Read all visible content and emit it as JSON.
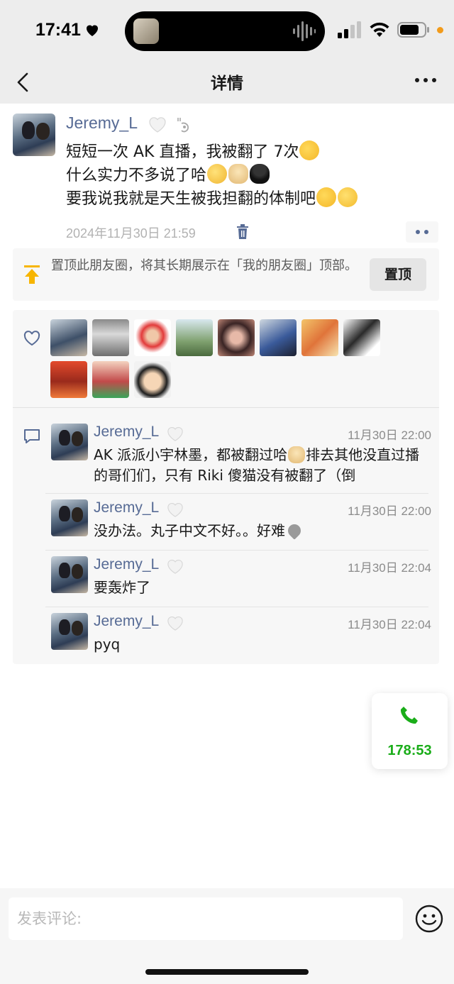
{
  "status_bar": {
    "time": "17:41"
  },
  "nav": {
    "title": "详情"
  },
  "post": {
    "author": "Jeremy_L",
    "text_lines": [
      "短短一次 AK 直播，我被翻了 7次",
      "什么实力不多说了哈",
      "要我说我就是天生被我担翻的体制吧"
    ],
    "timestamp": "2024年11月30日 21:59"
  },
  "pin_banner": {
    "text": "置顶此朋友圈，将其长期展示在「我的朋友圈」顶部。",
    "button_label": "置顶"
  },
  "likes": {
    "count_shown": 11
  },
  "comments": [
    {
      "name": "Jeremy_L",
      "time": "11月30日 22:00",
      "text_before_emoji": "AK 派派小宇林墨，都被翻过哈",
      "text_after_emoji": "排去其他没直过播的哥们们，只有 Riki 傻猫没有被翻了（倒"
    },
    {
      "name": "Jeremy_L",
      "time": "11月30日 22:00",
      "text": "没办法。丸子中文不好。。好难"
    },
    {
      "name": "Jeremy_L",
      "time": "11月30日 22:04",
      "text": "要轰炸了"
    },
    {
      "name": "Jeremy_L",
      "time": "11月30日 22:04",
      "text": "pyq"
    }
  ],
  "call": {
    "duration": "178:53",
    "accent": "#1aad19"
  },
  "composer": {
    "placeholder": "发表评论:"
  },
  "colors": {
    "name_link": "#576b95",
    "nav_bg": "#ededed",
    "pin_icon": "#f7b500"
  }
}
